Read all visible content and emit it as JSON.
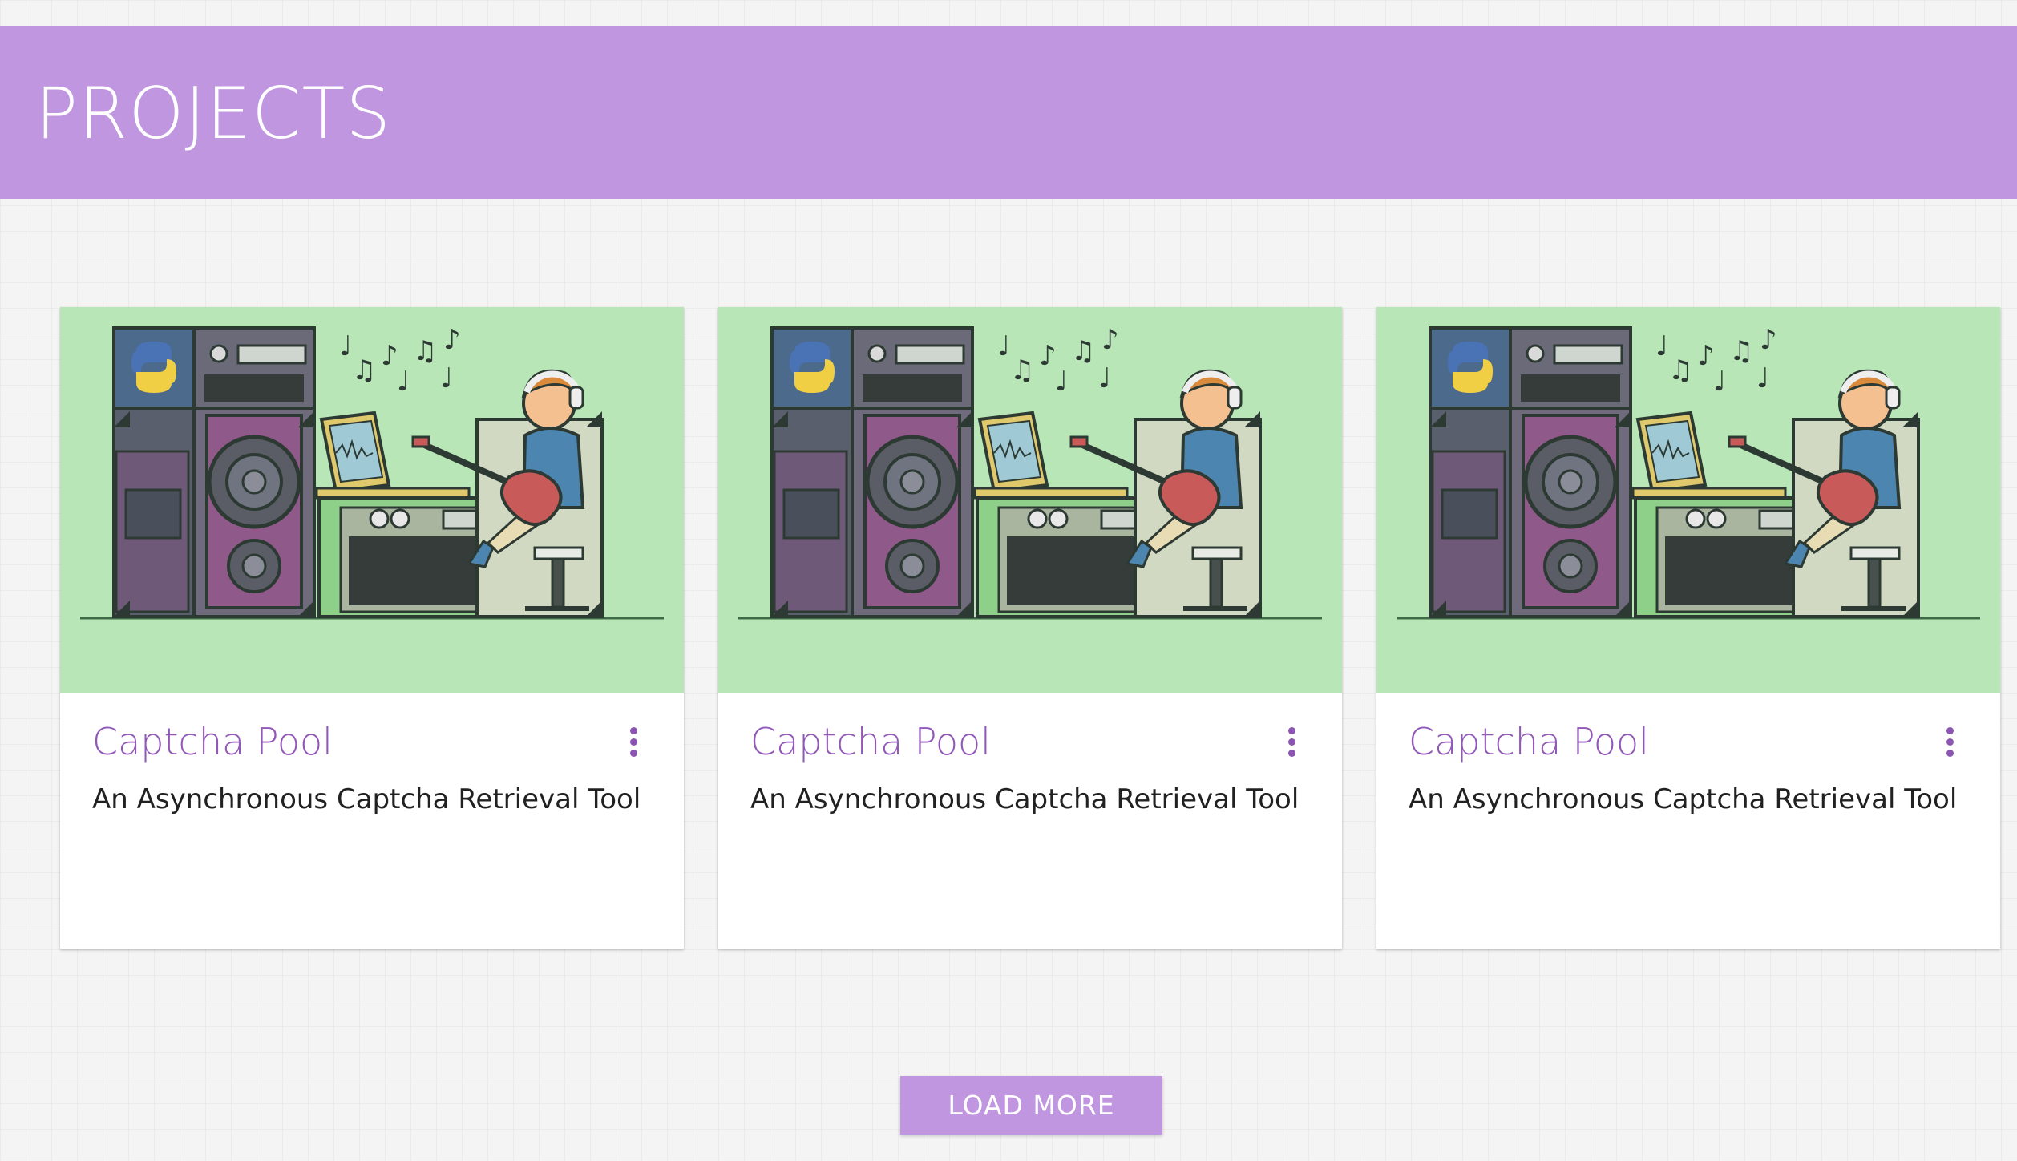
{
  "header": {
    "title": "PROJECTS",
    "color": "#c096e0"
  },
  "projects": [
    {
      "title": "Captcha Pool",
      "description": "An Asynchronous Captcha Retrieval Tool",
      "image": "musician-studio-illustration",
      "menu_icon": "more-vert-icon"
    },
    {
      "title": "Captcha Pool",
      "description": "An Asynchronous Captcha Retrieval Tool",
      "image": "musician-studio-illustration",
      "menu_icon": "more-vert-icon"
    },
    {
      "title": "Captcha Pool",
      "description": "An Asynchronous Captcha Retrieval Tool",
      "image": "musician-studio-illustration",
      "menu_icon": "more-vert-icon"
    }
  ],
  "load_more": {
    "label": "LOAD MORE"
  },
  "colors": {
    "accent": "#c096e0",
    "title_text": "#9158b8",
    "media_background": "#b8e6b7"
  }
}
